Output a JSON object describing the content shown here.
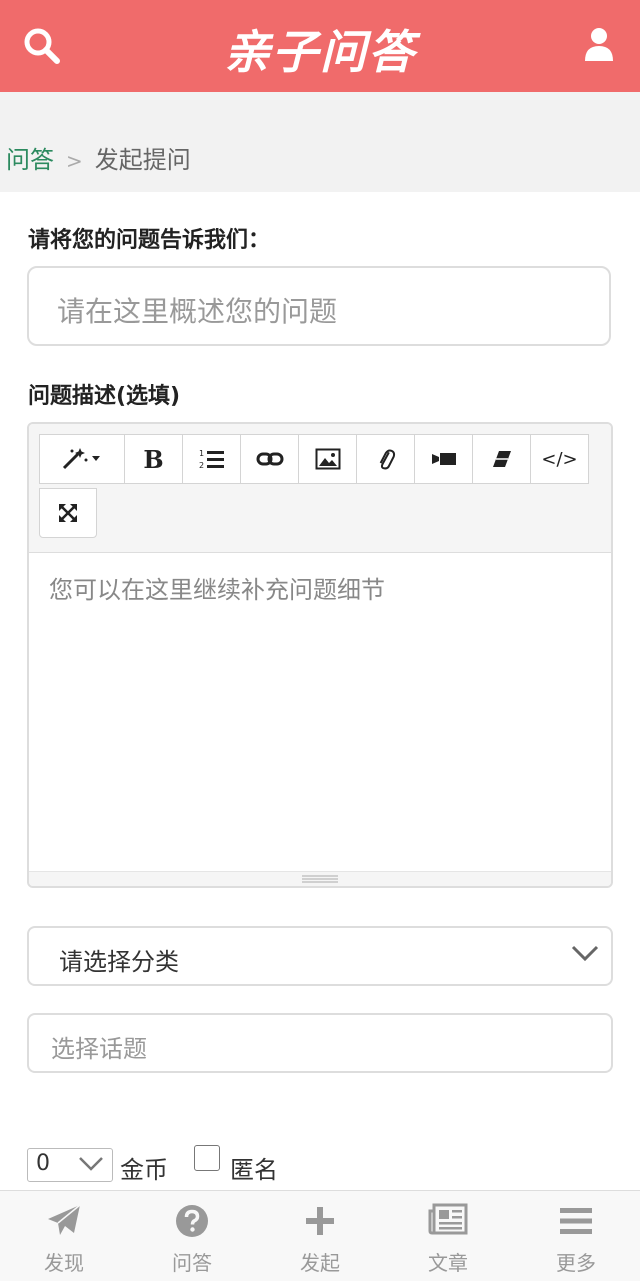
{
  "header": {
    "logo_text": "亲子问答"
  },
  "breadcrumb": {
    "home": "问答",
    "separator": ">",
    "current": "发起提问"
  },
  "form": {
    "title_label": "请将您的问题告诉我们：",
    "title_placeholder": "请在这里概述您的问题",
    "desc_label": "问题描述(选填)",
    "editor_placeholder": "您可以在这里继续补充问题细节",
    "category_placeholder": "请选择分类",
    "topic_placeholder": "选择话题",
    "coin_value": "0",
    "coin_label": "金币",
    "anonymous_label": "匿名"
  },
  "toolbar": {
    "bold": "B",
    "code": "</>"
  },
  "nav": [
    {
      "label": "发现",
      "icon": "paper-plane-icon"
    },
    {
      "label": "问答",
      "icon": "question-circle-icon"
    },
    {
      "label": "发起",
      "icon": "plus-icon"
    },
    {
      "label": "文章",
      "icon": "newspaper-icon"
    },
    {
      "label": "更多",
      "icon": "menu-bars-icon"
    }
  ],
  "colors": {
    "header_bg": "#f06b6b",
    "breadcrumb_link": "#2c8a5f",
    "nav_icon": "#999999"
  }
}
